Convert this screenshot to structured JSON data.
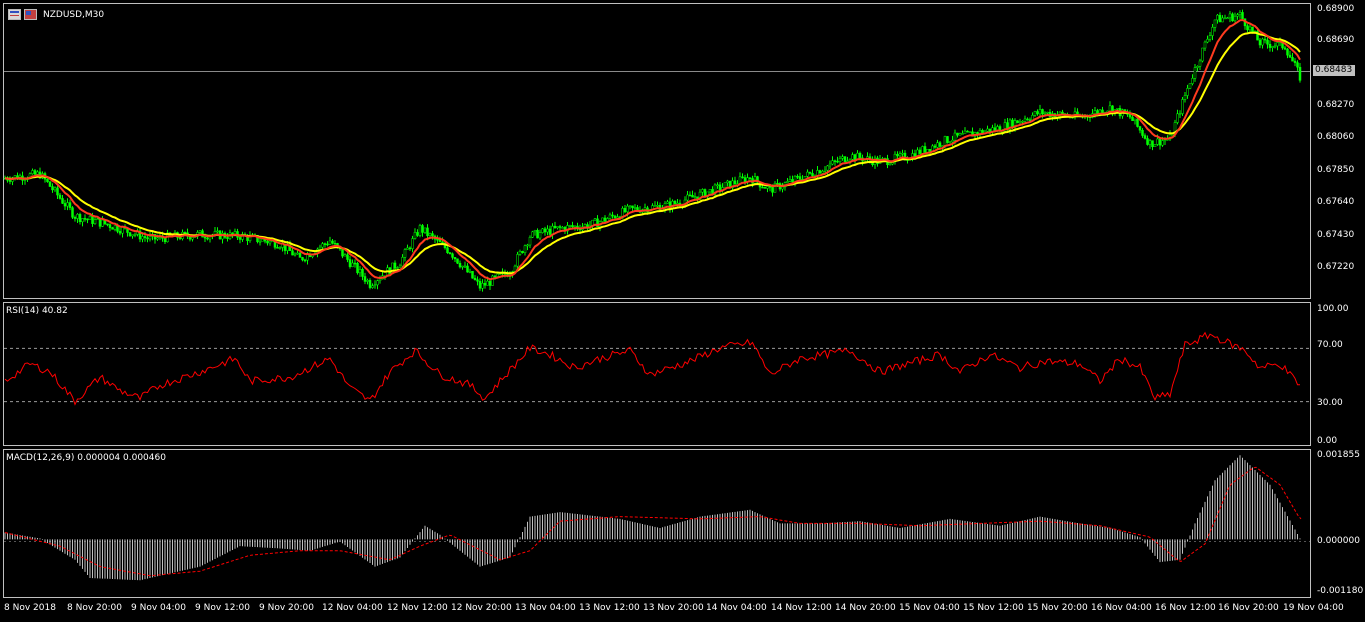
{
  "symbol_label": "NZDUSD,M30",
  "price_axis": [
    "0.68900",
    "0.68690",
    "0.68270",
    "0.68060",
    "0.67850",
    "0.67640",
    "0.67430",
    "0.67220"
  ],
  "current_price": "0.68483",
  "rsi": {
    "label": "RSI(14) 40.82",
    "axis": [
      "100.00",
      "70.00",
      "30.00",
      "0.00"
    ]
  },
  "macd": {
    "label": "MACD(12,26,9) 0.000004 0.000460",
    "axis": [
      "0.001855",
      "0.000000",
      "-0.001180"
    ]
  },
  "time_axis": [
    "8 Nov 2018",
    "8 Nov 20:00",
    "9 Nov 04:00",
    "9 Nov 12:00",
    "9 Nov 20:00",
    "12 Nov 04:00",
    "12 Nov 12:00",
    "12 Nov 20:00",
    "13 Nov 04:00",
    "13 Nov 12:00",
    "13 Nov 20:00",
    "14 Nov 04:00",
    "14 Nov 12:00",
    "14 Nov 20:00",
    "15 Nov 04:00",
    "15 Nov 12:00",
    "15 Nov 20:00",
    "16 Nov 04:00",
    "16 Nov 12:00",
    "16 Nov 20:00",
    "19 Nov 04:00"
  ],
  "colors": {
    "background": "#000000",
    "candles": "#00ff00",
    "ma_fast": "#ff3b1f",
    "ma_slow": "#ffff00",
    "rsi_line": "#ff0000",
    "macd_hist": "#c0c0c0",
    "macd_signal": "#ff0000",
    "grid": "#7a7a7a"
  },
  "chart_data": {
    "type": "line",
    "price_anchors": [
      [
        0,
        0.6782
      ],
      [
        40,
        0.6785
      ],
      [
        75,
        0.6758
      ],
      [
        110,
        0.6752
      ],
      [
        150,
        0.6743
      ],
      [
        200,
        0.6746
      ],
      [
        240,
        0.6745
      ],
      [
        280,
        0.674
      ],
      [
        300,
        0.673
      ],
      [
        330,
        0.6742
      ],
      [
        370,
        0.6714
      ],
      [
        400,
        0.6728
      ],
      [
        420,
        0.675
      ],
      [
        450,
        0.6735
      ],
      [
        480,
        0.6712
      ],
      [
        510,
        0.6722
      ],
      [
        530,
        0.6745
      ],
      [
        560,
        0.675
      ],
      [
        590,
        0.6752
      ],
      [
        630,
        0.6762
      ],
      [
        670,
        0.6765
      ],
      [
        710,
        0.6774
      ],
      [
        750,
        0.6783
      ],
      [
        770,
        0.6775
      ],
      [
        810,
        0.6785
      ],
      [
        850,
        0.6797
      ],
      [
        880,
        0.6793
      ],
      [
        910,
        0.6797
      ],
      [
        950,
        0.6808
      ],
      [
        1000,
        0.6815
      ],
      [
        1040,
        0.6825
      ],
      [
        1080,
        0.6822
      ],
      [
        1110,
        0.6828
      ],
      [
        1130,
        0.6822
      ],
      [
        1150,
        0.6805
      ],
      [
        1170,
        0.6808
      ],
      [
        1190,
        0.6845
      ],
      [
        1215,
        0.6885
      ],
      [
        1240,
        0.6888
      ],
      [
        1260,
        0.687
      ],
      [
        1285,
        0.6868
      ],
      [
        1300,
        0.6848
      ]
    ],
    "rsi_anchors": [
      [
        5,
        45
      ],
      [
        30,
        58
      ],
      [
        50,
        52
      ],
      [
        75,
        30
      ],
      [
        100,
        48
      ],
      [
        120,
        38
      ],
      [
        140,
        32
      ],
      [
        160,
        42
      ],
      [
        200,
        52
      ],
      [
        235,
        62
      ],
      [
        250,
        45
      ],
      [
        290,
        48
      ],
      [
        330,
        62
      ],
      [
        350,
        40
      ],
      [
        370,
        30
      ],
      [
        390,
        52
      ],
      [
        415,
        68
      ],
      [
        440,
        50
      ],
      [
        470,
        42
      ],
      [
        485,
        32
      ],
      [
        500,
        45
      ],
      [
        530,
        70
      ],
      [
        550,
        65
      ],
      [
        575,
        55
      ],
      [
        600,
        62
      ],
      [
        630,
        68
      ],
      [
        650,
        50
      ],
      [
        690,
        60
      ],
      [
        720,
        70
      ],
      [
        752,
        74
      ],
      [
        770,
        50
      ],
      [
        800,
        62
      ],
      [
        850,
        68
      ],
      [
        880,
        52
      ],
      [
        940,
        65
      ],
      [
        960,
        52
      ],
      [
        990,
        65
      ],
      [
        1020,
        55
      ],
      [
        1045,
        60
      ],
      [
        1080,
        58
      ],
      [
        1100,
        45
      ],
      [
        1120,
        62
      ],
      [
        1140,
        55
      ],
      [
        1155,
        32
      ],
      [
        1170,
        35
      ],
      [
        1185,
        72
      ],
      [
        1210,
        80
      ],
      [
        1245,
        68
      ],
      [
        1260,
        55
      ],
      [
        1280,
        58
      ],
      [
        1300,
        42
      ]
    ],
    "macd_anchors": [
      [
        5,
        0.00015
      ],
      [
        40,
        2e-05
      ],
      [
        75,
        -0.00045
      ],
      [
        90,
        -0.00085
      ],
      [
        140,
        -0.0009
      ],
      [
        200,
        -0.0006
      ],
      [
        240,
        -0.00015
      ],
      [
        280,
        -0.0002
      ],
      [
        310,
        -0.00025
      ],
      [
        340,
        -5e-05
      ],
      [
        375,
        -0.0006
      ],
      [
        400,
        -0.0004
      ],
      [
        425,
        0.0003
      ],
      [
        440,
        0.0001
      ],
      [
        480,
        -0.0006
      ],
      [
        510,
        -0.0004
      ],
      [
        530,
        0.0005
      ],
      [
        560,
        0.0006
      ],
      [
        620,
        0.00045
      ],
      [
        660,
        0.00025
      ],
      [
        700,
        0.0005
      ],
      [
        750,
        0.00065
      ],
      [
        780,
        0.00035
      ],
      [
        820,
        0.00035
      ],
      [
        860,
        0.0004
      ],
      [
        900,
        0.00025
      ],
      [
        950,
        0.00045
      ],
      [
        1000,
        0.0003
      ],
      [
        1040,
        0.0005
      ],
      [
        1080,
        0.00035
      ],
      [
        1110,
        0.00025
      ],
      [
        1140,
        5e-05
      ],
      [
        1160,
        -0.0005
      ],
      [
        1180,
        -0.00045
      ],
      [
        1195,
        0.00035
      ],
      [
        1215,
        0.0013
      ],
      [
        1240,
        0.00185
      ],
      [
        1270,
        0.0012
      ],
      [
        1300,
        2e-05
      ]
    ],
    "macd_signal_anchors": [
      [
        5,
        0.00015
      ],
      [
        60,
        -0.00015
      ],
      [
        100,
        -0.0006
      ],
      [
        150,
        -0.0008
      ],
      [
        200,
        -0.0007
      ],
      [
        250,
        -0.00035
      ],
      [
        300,
        -0.00025
      ],
      [
        340,
        -0.00025
      ],
      [
        390,
        -0.00045
      ],
      [
        420,
        -0.00015
      ],
      [
        450,
        0.0001
      ],
      [
        500,
        -0.00045
      ],
      [
        530,
        -0.00025
      ],
      [
        560,
        0.0004
      ],
      [
        620,
        0.0005
      ],
      [
        700,
        0.00045
      ],
      [
        760,
        0.0005
      ],
      [
        800,
        0.00035
      ],
      [
        860,
        0.00035
      ],
      [
        920,
        0.0003
      ],
      [
        980,
        0.00035
      ],
      [
        1040,
        0.0004
      ],
      [
        1100,
        0.0003
      ],
      [
        1150,
        5e-05
      ],
      [
        1180,
        -0.0005
      ],
      [
        1205,
        -0.0001
      ],
      [
        1230,
        0.0012
      ],
      [
        1255,
        0.0016
      ],
      [
        1280,
        0.0012
      ],
      [
        1300,
        0.00045
      ]
    ],
    "rsi_levels": [
      70,
      30
    ],
    "rsi_range": [
      0,
      100
    ],
    "macd_range": [
      -0.00118,
      0.001855
    ],
    "price_range": [
      0.671,
      0.689
    ]
  }
}
